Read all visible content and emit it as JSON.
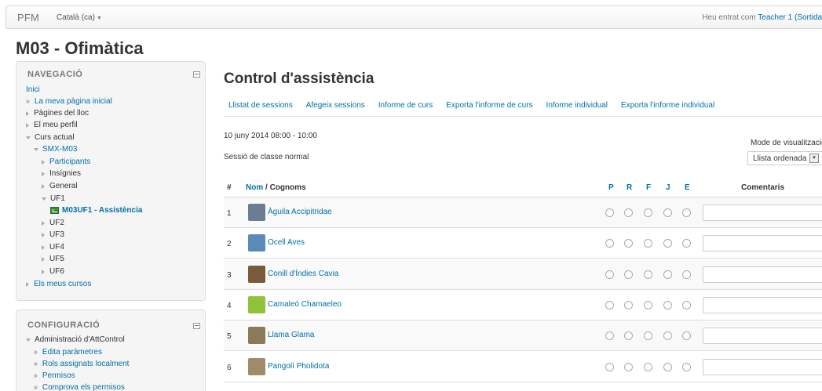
{
  "topbar": {
    "brand": "PFM",
    "language": "Català (ca)",
    "login_prefix": "Heu entrat com ",
    "login_user": "Teacher 1",
    "login_logout": "(Sortida"
  },
  "course_title": "M03 - Ofimàtica",
  "navigation": {
    "title": "NAVEGACIÓ",
    "items": [
      {
        "label": "Inici"
      },
      {
        "label": "La meva pàgina inicial"
      },
      {
        "label": "Pàgines del lloc"
      },
      {
        "label": "El meu perfil"
      },
      {
        "label": "Curs actual"
      },
      {
        "label": "SMX-M03"
      },
      {
        "label": "Participants"
      },
      {
        "label": "Insígnies"
      },
      {
        "label": "General"
      },
      {
        "label": "UF1"
      },
      {
        "label": "M03UF1 - Assistència"
      },
      {
        "label": "UF2"
      },
      {
        "label": "UF3"
      },
      {
        "label": "UF4"
      },
      {
        "label": "UF5"
      },
      {
        "label": "UF6"
      },
      {
        "label": "Els meus cursos"
      }
    ]
  },
  "settings": {
    "title": "CONFIGURACIÓ",
    "items": [
      {
        "label": "Administració d'AttControl"
      },
      {
        "label": "Edita paràmetres"
      },
      {
        "label": "Rols assignats localment"
      },
      {
        "label": "Permisos"
      },
      {
        "label": "Comprova els permisos"
      }
    ]
  },
  "main": {
    "title": "Control d'assistència",
    "tabs": [
      {
        "label": "Llistat de sessions"
      },
      {
        "label": "Afegeix sessions"
      },
      {
        "label": "Informe de curs"
      },
      {
        "label": "Exporta l'informe de curs"
      },
      {
        "label": "Informe individual"
      },
      {
        "label": "Exporta l'informe individual"
      }
    ],
    "session_date": "10 juny 2014 08:00 - 10:00",
    "session_desc": "Sessió de classe normal",
    "mode_label": "Mode de visualització",
    "mode_value": "Llista ordenada",
    "table": {
      "col_num": "#",
      "col_name": "Nom",
      "col_name_sep": " / Cognoms",
      "statuses": [
        "P",
        "R",
        "F",
        "J",
        "E"
      ],
      "col_comments": "Comentaris",
      "rows": [
        {
          "num": "1",
          "name": "Àguila Accipitridae",
          "avatar_color": "#6b7d92"
        },
        {
          "num": "2",
          "name": "Ocell Aves",
          "avatar_color": "#5a8bb8"
        },
        {
          "num": "3",
          "name": "Conill d'Índies Cavia",
          "avatar_color": "#7a5a3a"
        },
        {
          "num": "4",
          "name": "Camaleó Chamaeleo",
          "avatar_color": "#8fc43a"
        },
        {
          "num": "5",
          "name": "Llama Glama",
          "avatar_color": "#8a7a5a"
        },
        {
          "num": "6",
          "name": "Pangolí Pholidota",
          "avatar_color": "#a08a6a"
        }
      ]
    }
  }
}
